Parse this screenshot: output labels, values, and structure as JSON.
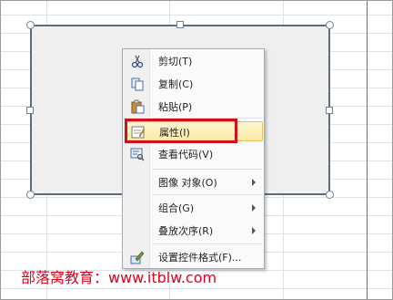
{
  "menu": {
    "items": [
      {
        "label": "剪切(T)",
        "icon": "scissors-icon"
      },
      {
        "label": "复制(C)",
        "icon": "copy-icon"
      },
      {
        "label": "粘贴(P)",
        "icon": "paste-icon"
      },
      {
        "label": "属性(I)",
        "icon": "properties-icon"
      },
      {
        "label": "查看代码(V)",
        "icon": "view-code-icon"
      },
      {
        "label": "图像 对象(O)",
        "icon": ""
      },
      {
        "label": "组合(G)",
        "icon": ""
      },
      {
        "label": "叠放次序(R)",
        "icon": ""
      },
      {
        "label": "设置控件格式(F)...",
        "icon": "format-control-icon"
      }
    ],
    "highlighted_item": "属性(I)"
  },
  "watermark": {
    "text": "部落窝教育：www.itblw.com"
  },
  "colors": {
    "highlight_border": "#d0101a",
    "watermark": "#e0001b",
    "hover_fill": "#fde9a3"
  }
}
